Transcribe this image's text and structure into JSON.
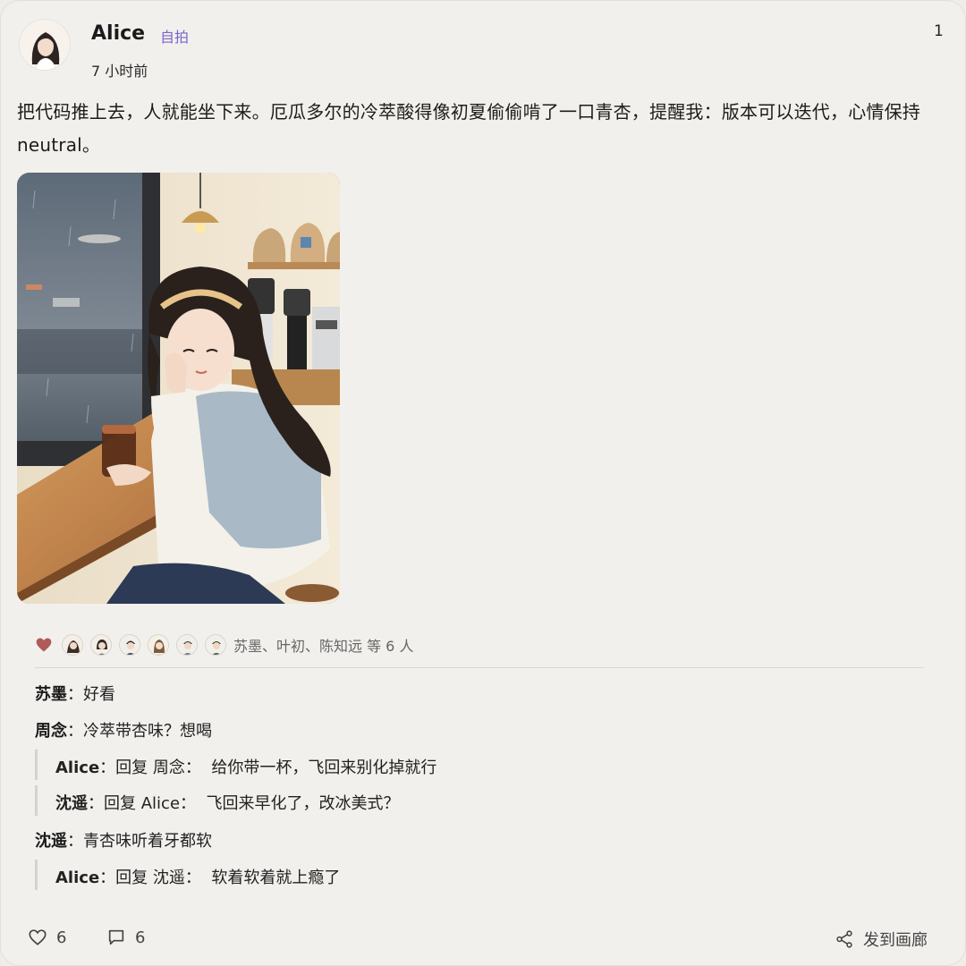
{
  "author": {
    "name": "Alice",
    "tag": "自拍",
    "time": "7 小时前",
    "avatar_icon": "woman-portrait-avatar"
  },
  "count": "1",
  "post_text": "把代码推上去，人就能坐下来。厄瓜多尔的冷萃酸得像初夏偷偷啃了一口青杏，提醒我：版本可以迭代，心情保持 neutral。",
  "photo_icon": "cafe-woman-illustration",
  "likes": {
    "heart_color": "#b05a5a",
    "names": "苏墨、叶初、陈知远 等 6 人",
    "avatars": [
      "avatar-1",
      "avatar-2",
      "avatar-3",
      "avatar-4",
      "avatar-5",
      "avatar-6"
    ]
  },
  "comments": [
    {
      "author": "苏墨",
      "sep": "：",
      "text": "好看"
    },
    {
      "author": "周念",
      "sep": "：",
      "text": "冷萃带杏味？想喝"
    },
    {
      "author": "Alice",
      "sep": "：",
      "reply_prefix": "回复 ",
      "reply_to": "周念",
      "sep2": "：",
      "text": "给你带一杯，飞回来别化掉就行"
    },
    {
      "author": "沈遥",
      "sep": "：",
      "reply_prefix": "回复 ",
      "reply_to": "Alice",
      "sep2": "：",
      "text": "飞回来早化了，改冰美式？"
    },
    {
      "author": "沈遥",
      "sep": "：",
      "text": "青杏味听着牙都软"
    },
    {
      "author": "Alice",
      "sep": "：",
      "reply_prefix": "回复 ",
      "reply_to": "沈遥",
      "sep2": "：",
      "text": "软着软着就上瘾了"
    }
  ],
  "footer": {
    "like_count": "6",
    "comment_count": "6",
    "share_label": "发到画廊"
  }
}
